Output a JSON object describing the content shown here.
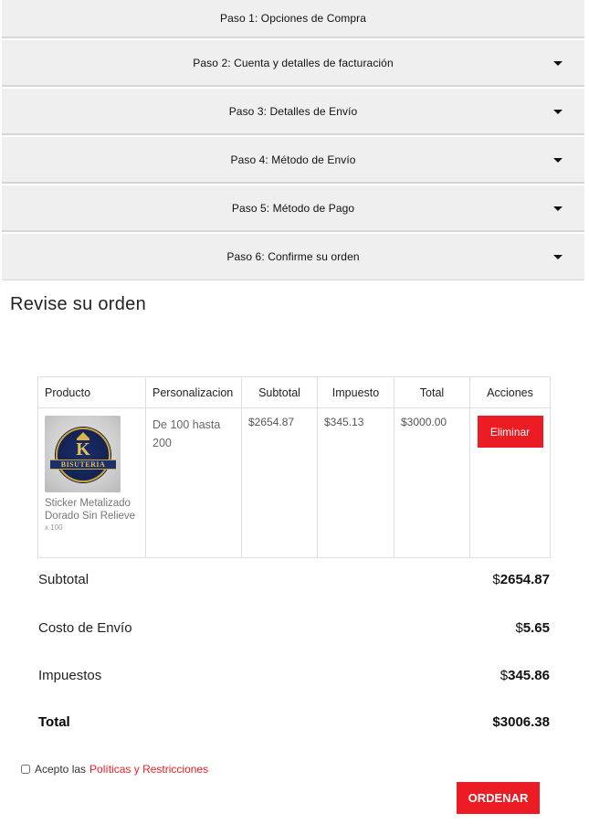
{
  "steps": [
    {
      "label": "Paso 1: Opciones de Compra",
      "caret": false
    },
    {
      "label": "Paso 2: Cuenta y detalles de facturación",
      "caret": true
    },
    {
      "label": "Paso 3: Detalles de Envío",
      "caret": true
    },
    {
      "label": "Paso 4: Método de Envío",
      "caret": true
    },
    {
      "label": "Paso 5: Método de Pago",
      "caret": true
    },
    {
      "label": "Paso 6: Confirme su orden",
      "caret": true
    }
  ],
  "review": {
    "title": "Revise su orden",
    "columns": [
      "Producto",
      "Personalizacion",
      "Subtotal",
      "Impuesto",
      "Total",
      "Acciones"
    ],
    "item": {
      "image_icon": "product-sticker-badge",
      "image_letter": "K",
      "image_text": "BISUTERIA",
      "name": "Sticker Metalizado Dorado Sin Relieve",
      "qty": "x 100",
      "personalization": "De 100 hasta 200",
      "subtotal": "$2654.87",
      "tax": "$345.13",
      "total": "$3000.00",
      "action_label": "Eliminar"
    }
  },
  "summary": [
    {
      "label": "Subtotal",
      "currency": "$",
      "amount": "2654.87"
    },
    {
      "label": "Costo de Envío",
      "currency": "$",
      "amount": "5.65"
    },
    {
      "label": "Impuestos",
      "currency": "$",
      "amount": "345.86"
    },
    {
      "label": "Total",
      "currency": "$",
      "amount": "3006.38"
    }
  ],
  "terms": {
    "prefix": "Acepto las",
    "link": "Políticas y Restricciones",
    "checked": false
  },
  "order_button": "ORDENAR",
  "colors": {
    "accent": "#ec1c24",
    "step_bg": "#efefef"
  }
}
